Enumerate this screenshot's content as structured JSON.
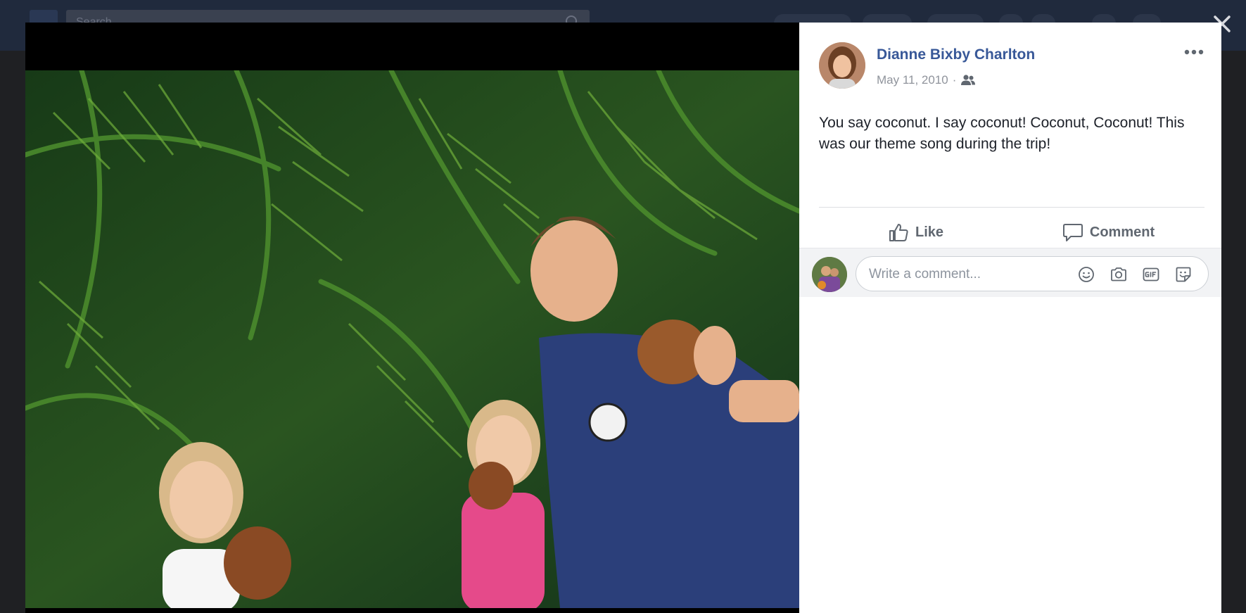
{
  "background_bar": {
    "search_placeholder": "Search"
  },
  "post": {
    "author": "Dianne Bixby Charlton",
    "date": "May 11, 2010",
    "separator": "·",
    "audience_icon": "friends-icon",
    "text": "You say coconut. I say coconut! Coconut, Coconut! This was our theme song during the trip!"
  },
  "actions": {
    "like_label": "Like",
    "comment_label": "Comment"
  },
  "comment_box": {
    "placeholder": "Write a comment...",
    "icons": [
      "emoji-icon",
      "camera-icon",
      "gif-icon",
      "sticker-icon"
    ]
  },
  "colors": {
    "link": "#385898",
    "meta": "#90949c",
    "action": "#606770"
  }
}
